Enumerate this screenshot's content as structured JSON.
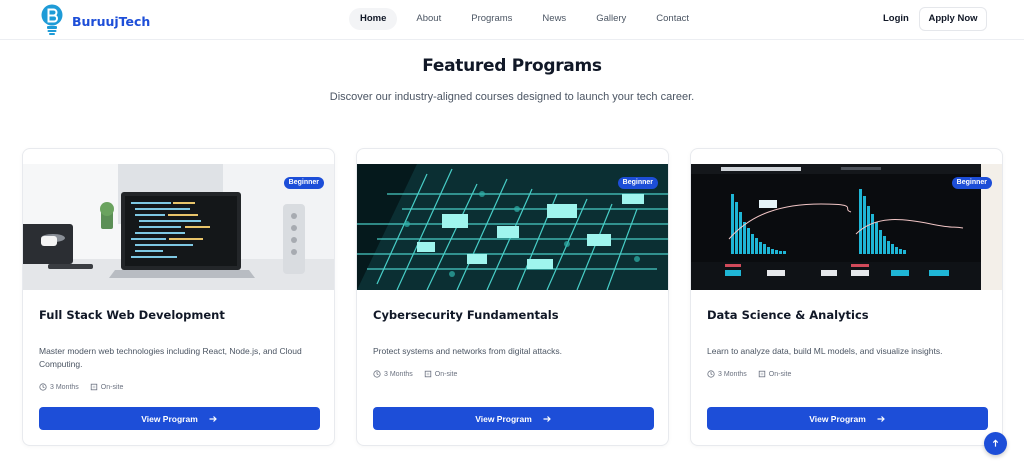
{
  "brand": {
    "name": "BuruujTech",
    "logo_icon": "lightbulb-b-logo-icon",
    "color": "#1d4ed8"
  },
  "nav": {
    "items": [
      {
        "label": "Home",
        "active": true
      },
      {
        "label": "About",
        "active": false
      },
      {
        "label": "Programs",
        "active": false
      },
      {
        "label": "News",
        "active": false
      },
      {
        "label": "Gallery",
        "active": false
      },
      {
        "label": "Contact",
        "active": false
      }
    ],
    "login_label": "Login",
    "apply_label": "Apply Now"
  },
  "section": {
    "title": "Featured Programs",
    "subtitle": "Discover our industry-aligned courses designed to launch your tech career."
  },
  "programs": [
    {
      "badge": "Beginner",
      "image": "laptop-code-photo",
      "title": "Full Stack Web Development",
      "description": "Master modern web technologies including React, Node.js, and Cloud Computing.",
      "duration": "3 Months",
      "mode": "On-site",
      "button_label": "View Program"
    },
    {
      "badge": "Beginner",
      "image": "circuit-board-photo",
      "title": "Cybersecurity Fundamentals",
      "description": "Protect systems and networks from digital attacks.",
      "duration": "3 Months",
      "mode": "On-site",
      "button_label": "View Program"
    },
    {
      "badge": "Beginner",
      "image": "analytics-dashboard-photo",
      "title": "Data Science & Analytics",
      "description": "Learn to analyze data, build ML models, and visualize insights.",
      "duration": "3 Months",
      "mode": "On-site",
      "button_label": "View Program"
    }
  ],
  "icons": {
    "clock": "clock-icon",
    "building": "building-icon",
    "arrow": "arrow-right-icon",
    "scroll_top": "arrow-up-icon"
  },
  "colors": {
    "accent": "#1d4ed8",
    "text": "#111827",
    "muted": "#4b5563"
  }
}
